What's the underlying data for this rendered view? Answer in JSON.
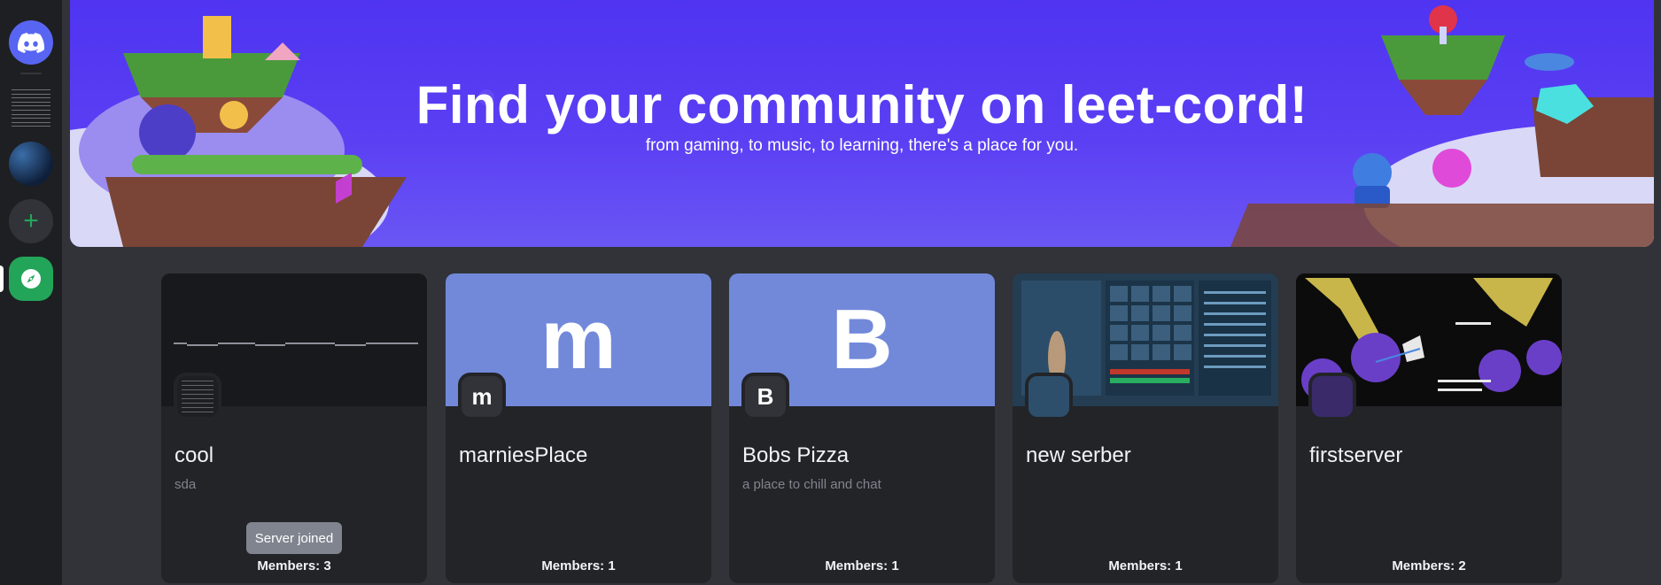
{
  "rail": {
    "home_icon": "discord-logo-icon",
    "add_icon": "plus-icon",
    "explore_icon": "compass-icon",
    "colors": {
      "rail_bg": "#1e1f22",
      "home_bg": "#5865f2",
      "accent_green": "#23a559"
    }
  },
  "banner": {
    "title": "Find your community on leet-cord!",
    "subtitle": "from gaming, to music, to learning, there's a place for you."
  },
  "servers": [
    {
      "name": "cool",
      "description": "sda",
      "members": "Members: 3",
      "badge": "Server joined",
      "icon_letter": "",
      "banner_letter": ""
    },
    {
      "name": "marniesPlace",
      "description": "",
      "members": "Members: 1",
      "icon_letter": "m",
      "banner_letter": "m",
      "banner_color": "#7289da"
    },
    {
      "name": "Bobs Pizza",
      "description": "a place to chill and chat",
      "members": "Members: 1",
      "icon_letter": "B",
      "banner_letter": "B",
      "banner_color": "#7289da"
    },
    {
      "name": "new serber",
      "description": "",
      "members": "Members: 1",
      "icon_letter": "",
      "banner_letter": ""
    },
    {
      "name": "firstserver",
      "description": "",
      "members": "Members: 2",
      "icon_letter": "",
      "banner_letter": ""
    }
  ]
}
